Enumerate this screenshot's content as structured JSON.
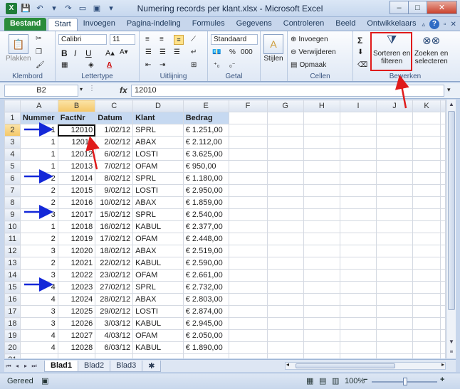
{
  "window": {
    "title": "Numering records per klant.xlsx - Microsoft Excel",
    "logo": "X",
    "controls": {
      "minimize": "–",
      "maximize": "□",
      "close": "✕"
    }
  },
  "tabs": [
    "Bestand",
    "Start",
    "Invoegen",
    "Pagina-indeling",
    "Formules",
    "Gegevens",
    "Controleren",
    "Beeld",
    "Ontwikkelaars"
  ],
  "active_tab": "Start",
  "ribbon": {
    "klembord": {
      "label": "Klembord",
      "paste": "Plakken"
    },
    "lettertype": {
      "label": "Lettertype",
      "font": "Calibri",
      "size": "11"
    },
    "uitlijning": {
      "label": "Uitlijning"
    },
    "getal": {
      "label": "Getal",
      "format": "Standaard",
      "percent": "%",
      "thousands": "000"
    },
    "stijlen": {
      "label": "Stijlen"
    },
    "cellen": {
      "label": "Cellen",
      "insert": "Invoegen",
      "delete": "Verwijderen",
      "format": "Opmaak"
    },
    "bewerken": {
      "label": "Bewerken",
      "sort1": "Sorteren en",
      "sort2": "filteren",
      "find1": "Zoeken en",
      "find2": "selecteren",
      "sigma": "Σ"
    }
  },
  "formula_bar": {
    "name_box": "B2",
    "fx": "fx",
    "value": "12010"
  },
  "columns": [
    "A",
    "B",
    "C",
    "D",
    "E",
    "F",
    "G",
    "H",
    "I",
    "J",
    "K"
  ],
  "selected_column": "B",
  "selected_row": 2,
  "headers": [
    "Nummer",
    "FactNr",
    "Datum",
    "Klant",
    "Bedrag"
  ],
  "rows": [
    [
      "1",
      "12010",
      "1/02/12",
      "SPRL",
      "€ 1.251,00"
    ],
    [
      "1",
      "12011",
      "2/02/12",
      "ABAX",
      "€ 2.112,00"
    ],
    [
      "1",
      "12012",
      "6/02/12",
      "LOSTI",
      "€ 3.625,00"
    ],
    [
      "1",
      "12013",
      "7/02/12",
      "OFAM",
      "€    950,00"
    ],
    [
      "2",
      "12014",
      "8/02/12",
      "SPRL",
      "€ 1.180,00"
    ],
    [
      "2",
      "12015",
      "9/02/12",
      "LOSTI",
      "€ 2.950,00"
    ],
    [
      "2",
      "12016",
      "10/02/12",
      "ABAX",
      "€ 1.859,00"
    ],
    [
      "3",
      "12017",
      "15/02/12",
      "SPRL",
      "€ 2.540,00"
    ],
    [
      "1",
      "12018",
      "16/02/12",
      "KABUL",
      "€ 2.377,00"
    ],
    [
      "2",
      "12019",
      "17/02/12",
      "OFAM",
      "€ 2.448,00"
    ],
    [
      "3",
      "12020",
      "18/02/12",
      "ABAX",
      "€ 2.519,00"
    ],
    [
      "2",
      "12021",
      "22/02/12",
      "KABUL",
      "€ 2.590,00"
    ],
    [
      "3",
      "12022",
      "23/02/12",
      "OFAM",
      "€ 2.661,00"
    ],
    [
      "4",
      "12023",
      "27/02/12",
      "SPRL",
      "€ 2.732,00"
    ],
    [
      "4",
      "12024",
      "28/02/12",
      "ABAX",
      "€ 2.803,00"
    ],
    [
      "3",
      "12025",
      "29/02/12",
      "LOSTI",
      "€ 2.874,00"
    ],
    [
      "3",
      "12026",
      "3/03/12",
      "KABUL",
      "€ 2.945,00"
    ],
    [
      "4",
      "12027",
      "4/03/12",
      "OFAM",
      "€ 2.050,00"
    ],
    [
      "4",
      "12028",
      "6/03/12",
      "KABUL",
      "€ 1.890,00"
    ]
  ],
  "row_numbers": [
    "1",
    "2",
    "3",
    "4",
    "5",
    "6",
    "7",
    "8",
    "9",
    "10",
    "11",
    "12",
    "13",
    "14",
    "15",
    "16",
    "17",
    "18",
    "19",
    "20",
    "21"
  ],
  "sheets": [
    "Blad1",
    "Blad2",
    "Blad3"
  ],
  "active_sheet": "Blad1",
  "status": {
    "ready": "Gereed",
    "zoom": "100%",
    "minus": "−",
    "plus": "+"
  },
  "annotations": {
    "arrow_color": "#1428d8",
    "highlight_color": "#e01b1b"
  }
}
